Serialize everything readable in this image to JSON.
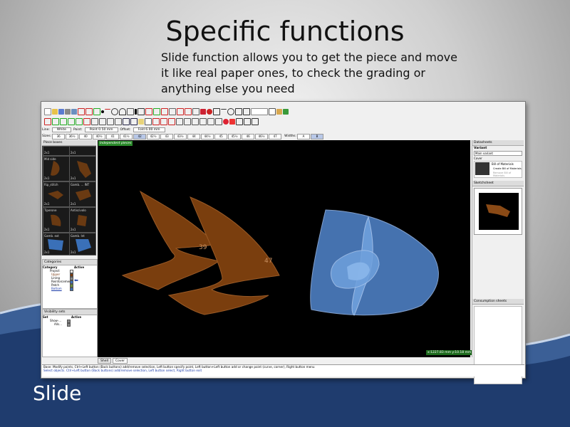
{
  "slide": {
    "title": "Specific functions",
    "description": "Slide function allows you to get the piece and move it like real paper ones, to check the grading or anything else you need",
    "footer_label": "Slide"
  },
  "app": {
    "props": {
      "line_label": "Line:",
      "line_value": "White",
      "point_label": "Point:",
      "point_value": "Point 0.50 mm",
      "offset_label": "Offset:",
      "offset_value": "Fold 6.00 mm"
    },
    "sizes_label": "Sizes:",
    "sizes": [
      "36",
      "36½",
      "40",
      "40½",
      "41",
      "41½",
      "42",
      "42½",
      "43",
      "43½",
      "44",
      "44½",
      "45",
      "45½",
      "46",
      "46½",
      "47"
    ],
    "active_size": "42",
    "widths_label": "Widths:",
    "widths": [
      "A",
      "B"
    ],
    "active_width": "B",
    "panels": {
      "piece_boxes": "Piece boxes",
      "categories": "Categories",
      "visibility": "Visibility sets",
      "datasheets": "Datasheets",
      "sketchsheet": "Sketchsheet",
      "consumption": "Consumption sheets"
    },
    "pieces": [
      {
        "name": "",
        "size": "2x1"
      },
      {
        "name": "",
        "size": "2x1"
      },
      {
        "name": "Mid side",
        "size": "2x1"
      },
      {
        "name": "",
        "size": "2x1"
      },
      {
        "name": "Rip_stitch",
        "size": "2x1"
      },
      {
        "name": "Gamb. ... INT",
        "size": "2x1"
      },
      {
        "name": "Tiperone",
        "size": "2x1"
      },
      {
        "name": "Antiscivolo",
        "size": "2x1"
      },
      {
        "name": "Gamb. ext",
        "size": "2x1"
      },
      {
        "name": "Gamb. Int",
        "size": "2x1"
      }
    ],
    "categories": {
      "col_category": "Category",
      "col_active": "Active",
      "items": [
        "Project",
        "Upper",
        "Lining",
        "Reinforcement",
        "Patch",
        "Bottom"
      ]
    },
    "visibility": {
      "col_set": "Set",
      "col_active": "Active",
      "items": [
        "Show-...",
        "Alls..."
      ]
    },
    "datasheets": {
      "variant_label": "Variant",
      "variant_value": "Main variant",
      "cover_label": "Cover",
      "bom_title": "Bill of Materials",
      "create_bom": "Create Bill of Materials",
      "remove_bom": "Remove Bill of Materials"
    },
    "canvas": {
      "tag": "Independent pieces",
      "piece_label_1": "39",
      "piece_label_2": "47",
      "coord": "x:1227.83 mm  y:10.18 mm"
    },
    "tabs": [
      "Shell",
      "Cover"
    ],
    "status_line_1": "Base: Modify points, Ctrl+Left button (Back buttons) add/remove selection, Left button specify point, Left button+Left button add or change point (curve, corner), Right button menu",
    "status_line_2": "Select objects. Ctrl+Left button (Back buttons) add/remove selection, Left button select, Right button exit"
  }
}
